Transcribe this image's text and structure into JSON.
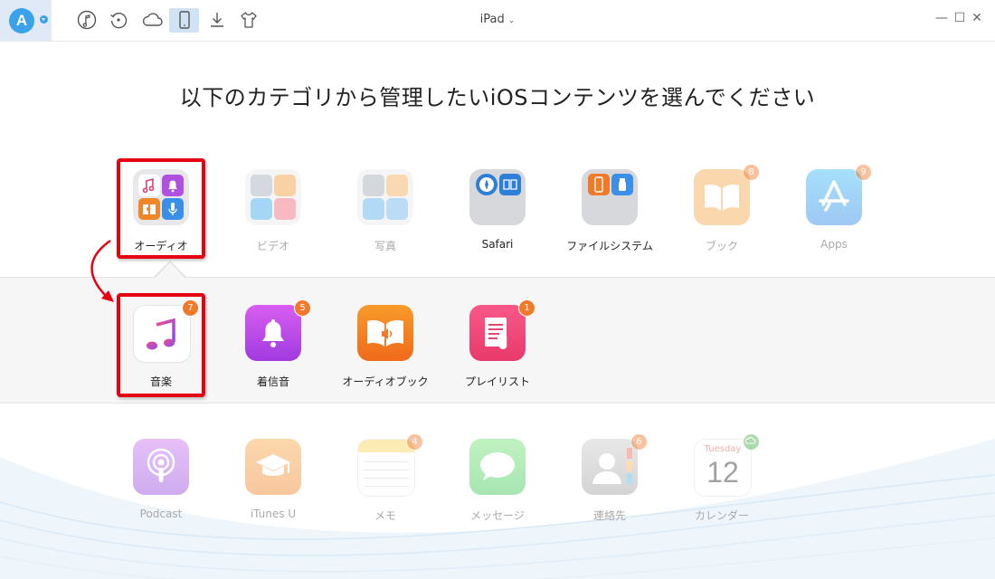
{
  "titlebar": {
    "app_logo_letter": "A",
    "device_name": "iPad",
    "device_chevron": "⌄",
    "toolbar_icons": [
      "music-icon",
      "restore-icon",
      "cloud-icon",
      "device-icon",
      "download-icon",
      "tshirt-icon"
    ],
    "window_buttons": [
      "—",
      "☐",
      "✕"
    ]
  },
  "main": {
    "heading": "以下のカテゴリから管理したいiOSコンテンツを選んでください"
  },
  "categories": [
    {
      "label": "オーディオ",
      "badge": ""
    },
    {
      "label": "ビデオ",
      "badge": ""
    },
    {
      "label": "写真",
      "badge": ""
    },
    {
      "label": "Safari",
      "badge": ""
    },
    {
      "label": "ファイルシステム",
      "badge": ""
    },
    {
      "label": "ブック",
      "badge": "8"
    },
    {
      "label": "Apps",
      "badge": "9"
    }
  ],
  "audio_sub": [
    {
      "label": "音楽",
      "badge": "7"
    },
    {
      "label": "着信音",
      "badge": "5"
    },
    {
      "label": "オーディオブック",
      "badge": ""
    },
    {
      "label": "プレイリスト",
      "badge": "1"
    }
  ],
  "others": [
    {
      "label": "Podcast",
      "badge": ""
    },
    {
      "label": "iTunes U",
      "badge": ""
    },
    {
      "label": "メモ",
      "badge": "4"
    },
    {
      "label": "メッセージ",
      "badge": ""
    },
    {
      "label": "連絡先",
      "badge": "6"
    },
    {
      "label": "カレンダー",
      "badge": ""
    }
  ],
  "calendar_icon": {
    "weekday": "Tuesday",
    "day": "12"
  },
  "colors": {
    "accent": "#3aa2ea",
    "highlight": "#e50012",
    "badge": "#f07a2a"
  }
}
